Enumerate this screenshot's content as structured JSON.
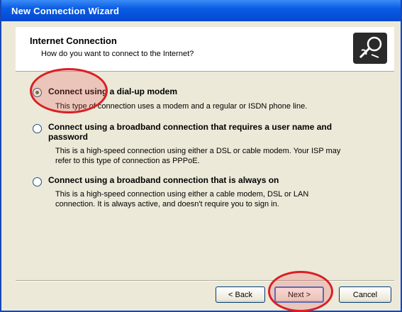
{
  "window": {
    "title": "New Connection Wizard"
  },
  "header": {
    "title": "Internet Connection",
    "subtitle": "How do you want to connect to the Internet?",
    "icon": "wizard-connection-icon"
  },
  "options": [
    {
      "label": "Connect using a dial-up modem",
      "description": "This type of connection uses a modem and a regular or ISDN phone line.",
      "checked": true
    },
    {
      "label": "Connect using a broadband connection that requires a user name and password",
      "label_line1": "Connect using a broadband connection that requires a user name and",
      "label_line2": "password",
      "description_line1": "This is a high-speed connection using either a DSL or cable modem. Your ISP may",
      "description_line2": "refer to this type of connection as PPPoE.",
      "checked": false
    },
    {
      "label": "Connect using a broadband connection that is always on",
      "description_line1": "This is a high-speed connection using either a cable modem, DSL or LAN",
      "description_line2": "connection. It is always active, and doesn't require you to sign in.",
      "checked": false
    }
  ],
  "buttons": {
    "back": "< Back",
    "next": "Next >",
    "cancel": "Cancel"
  },
  "annotations": {
    "color": "#d91f26"
  }
}
